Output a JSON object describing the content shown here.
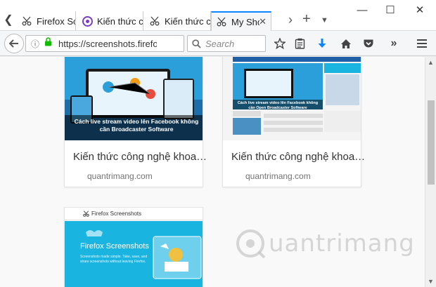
{
  "tabs": [
    {
      "label": "Firefox Screenshots",
      "icon": "scissors-icon"
    },
    {
      "label": "Kiến thức công nghệ",
      "icon": "quantrimang-icon"
    },
    {
      "label": "Kiến thức công nghệ",
      "icon": "scissors-icon"
    },
    {
      "label": "My Shots",
      "icon": "scissors-icon"
    }
  ],
  "navbar": {
    "url": "https://screenshots.firefox.com",
    "search_placeholder": "Search"
  },
  "cards": [
    {
      "title": "Kiến thức công nghệ khoa…",
      "site": "quantrimang.com",
      "thumb_caption": "Cách live stream video lên Facebook không cần Broadcaster Software"
    },
    {
      "title": "Kiến thức công nghệ khoa…",
      "site": "quantrimang.com",
      "thumb_caption": "Cách live stream video lên Facebook không cần Open Broadcaster Software"
    },
    {
      "title": "",
      "site": "",
      "thumb_header": "Firefox Screenshots",
      "thumb_heading": "Firefox Screenshots",
      "thumb_body": "Screenshots made simple. Take, save, and share screenshots without leaving Firefox."
    }
  ],
  "watermark": "uantrimang",
  "colors": {
    "accent": "#0a84ff",
    "download_arrow": "#0a84ff",
    "lock": "#12bc00",
    "card_thumb_blue": "#1ab4e0"
  }
}
